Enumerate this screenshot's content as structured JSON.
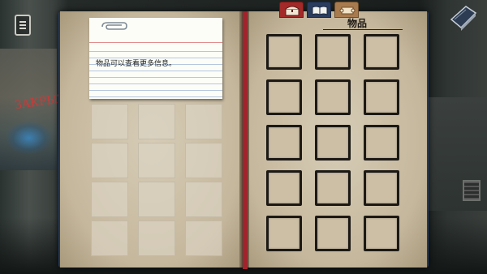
{
  "note": {
    "text": "物品可以查看更多信息。"
  },
  "inventory": {
    "title": "物品",
    "slot_count": 15,
    "empty_slots": [
      "",
      "",
      "",
      "",
      "",
      "",
      "",
      "",
      "",
      "",
      "",
      "",
      "",
      "",
      ""
    ]
  },
  "notes_grid": {
    "cell_count": 12
  },
  "tabs": [
    {
      "name": "inventory",
      "icon": "chest-icon",
      "active": true
    },
    {
      "name": "document",
      "icon": "open-book-icon",
      "active": false
    },
    {
      "name": "map",
      "icon": "scroll-icon",
      "active": false
    }
  ],
  "background": {
    "graffiti": "ЗАКРЫТ"
  },
  "colors": {
    "book_cover": "#243a5e",
    "bookmark": "#a3232c",
    "page": "#cbbfa8"
  }
}
